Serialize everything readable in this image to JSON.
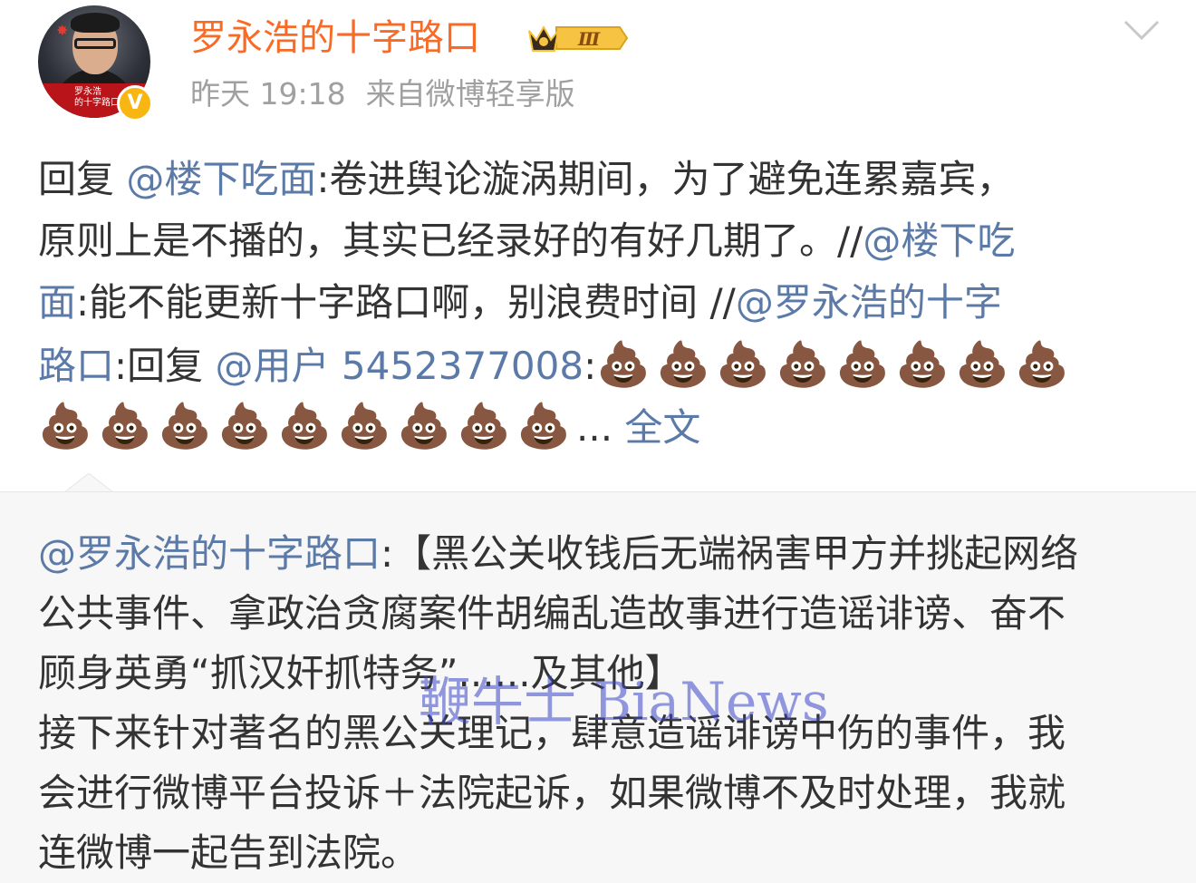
{
  "header": {
    "username": "罗永浩的十字路口",
    "member_level": "Ⅲ",
    "timestamp": "昨天 19:18",
    "source": "来自微博轻享版",
    "avatar_text": "罗永浩\n的十字路口",
    "verified_mark": "V"
  },
  "post": {
    "reply_prefix": "回复",
    "mention_1": "@楼下吃面",
    "text_1": ":卷进舆论漩涡期间，为了避免连累嘉宾，",
    "text_2": "原则上是不播的，其实已经录好的有好几期了。//",
    "mention_2a": "@楼下吃",
    "mention_2b": "面",
    "text_3": ":能不能更新十字路口啊，别浪费时间 //",
    "mention_3a": "@罗永浩的十字",
    "mention_3b": "路口",
    "text_4": ":回复 ",
    "mention_4": "@用户 5452377008",
    "text_5": ":",
    "emoji_row_1": [
      "💩",
      "💩",
      "💩",
      "💩",
      "💩",
      "💩",
      "💩",
      "💩"
    ],
    "emoji_row_2": [
      "💩",
      "💩",
      "💩",
      "💩",
      "💩",
      "💩",
      "💩",
      "💩",
      "💩"
    ],
    "ellipsis": "... ",
    "full_text_link": "全文"
  },
  "repost": {
    "mention": "@罗永浩的十字路口",
    "line_1": ":【黑公关收钱后无端祸害甲方并挑起网络",
    "line_2": "公共事件、拿政治贪腐案件胡编乱造故事进行造谣诽谤、奋不",
    "line_3": "顾身英勇“抓汉奸抓特务”......及其他】",
    "line_4": "接下来针对著名的黑公关理记，肆意造谣诽谤中伤的事件，我",
    "line_5": "会进行微博平台投诉＋法院起诉，如果微博不及时处理，我就",
    "line_6": "连微博一起告到法院。"
  },
  "watermark": "鞭牛士 BiaNews",
  "colors": {
    "username": "#f86b26",
    "mention": "#5b7aa8",
    "meta": "#a0a0a0",
    "repost_bg": "#f7f7f7",
    "verified": "#f8b612"
  }
}
